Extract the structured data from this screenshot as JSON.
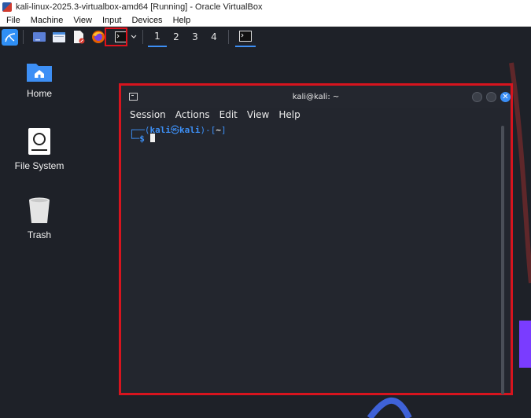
{
  "host_window": {
    "title": "kali-linux-2025.3-virtualbox-amd64 [Running] - Oracle VirtualBox",
    "menu": [
      "File",
      "Machine",
      "View",
      "Input",
      "Devices",
      "Help"
    ]
  },
  "panel": {
    "launchers": [
      "kali-menu-icon",
      "desktop-icon",
      "file-manager-icon",
      "text-editor-icon",
      "firefox-icon",
      "terminal-icon",
      "chevron-down-icon"
    ],
    "workspaces": [
      "1",
      "2",
      "3",
      "4"
    ],
    "active_workspace": "1"
  },
  "desktop": {
    "icons": [
      {
        "label": "Home",
        "icon": "home-folder-icon"
      },
      {
        "label": "File System",
        "icon": "drive-icon"
      },
      {
        "label": "Trash",
        "icon": "trash-icon"
      }
    ]
  },
  "terminal": {
    "title": "kali@kali: ~",
    "menu": [
      "Session",
      "Actions",
      "Edit",
      "View",
      "Help"
    ],
    "prompt": {
      "user": "kali",
      "at": "㉿",
      "host": "kali",
      "dir": "~",
      "symbol": "$"
    }
  },
  "colors": {
    "highlight": "#e0121c",
    "accent": "#3d8ff5",
    "panel_bg": "#1e2128"
  }
}
